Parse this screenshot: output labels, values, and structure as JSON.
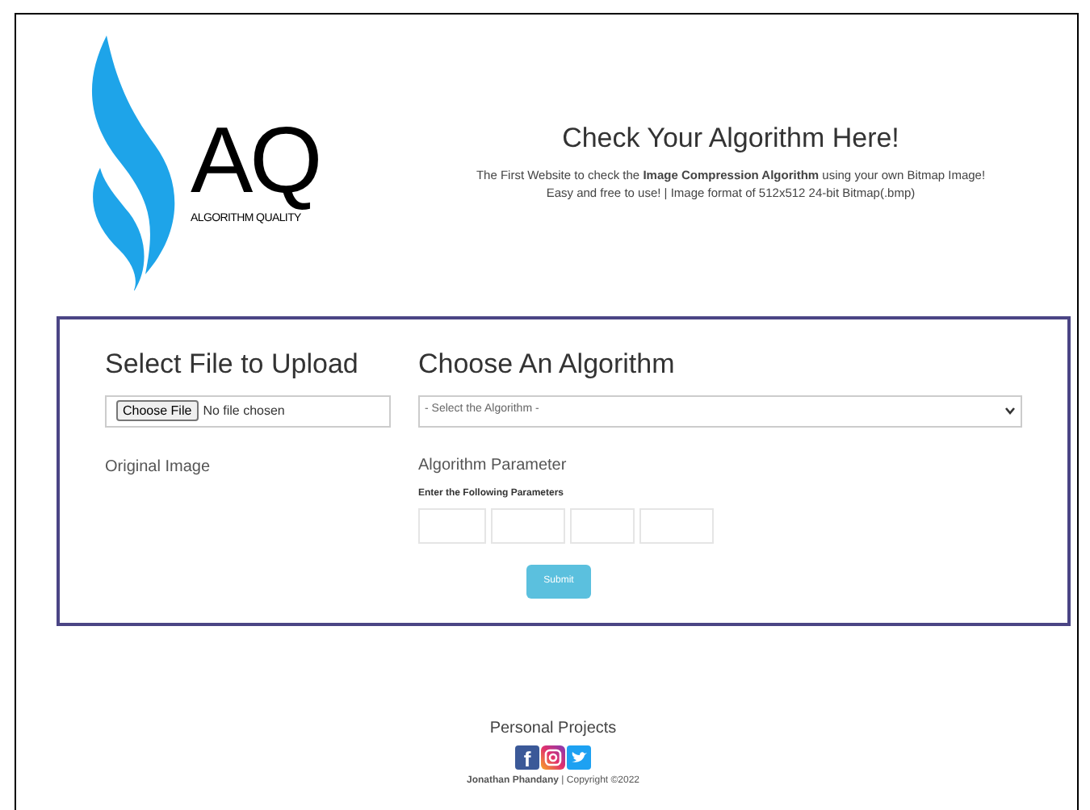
{
  "logo": {
    "mark": "AQ",
    "tagline": "ALGORITHM QUALITY"
  },
  "header": {
    "title": "Check Your Algorithm Here!",
    "lines": [
      "The First Website to check the **Image Compression Algorithm** using your own Bitmap Image!",
      "Easy and free to use! | Image format of 512x512 24-bit Bitmap(.bmp)"
    ]
  },
  "upload": {
    "heading": "Select File to Upload",
    "button": "Choose File",
    "status": "No file chosen",
    "preview_label": "Original Image"
  },
  "algorithm": {
    "heading": "Choose An Algorithm",
    "select": "- Select the Algorithm -",
    "parameter_heading": "Algorithm Parameter",
    "instruction": "Enter the Following Parameters",
    "parameters": [
      {
        "kind": "input"
      },
      {
        "kind": "input"
      },
      {
        "kind": "input"
      },
      {
        "kind": "input"
      }
    ]
  },
  "submit": "Submit",
  "footer": {
    "title": "Personal Projects",
    "facebook_glyph": "f",
    "author": "Jonathan Phandany",
    "copyright": " | Copyright ©2022"
  }
}
